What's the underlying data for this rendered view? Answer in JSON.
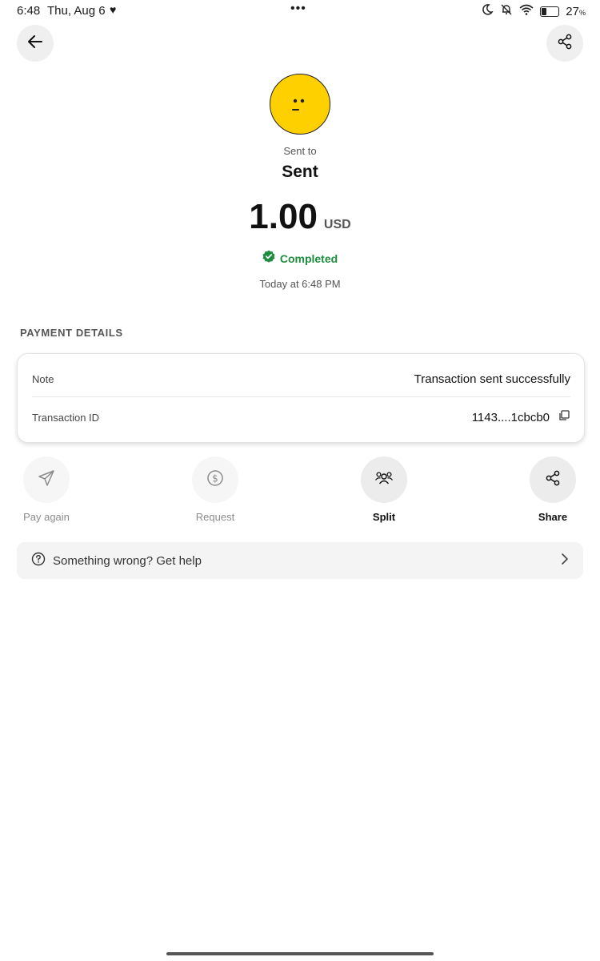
{
  "status_bar": {
    "time": "6:48",
    "date": "Thu, Aug 6",
    "battery_percent": "27",
    "battery_suffix": "%",
    "battery_level": 0.27
  },
  "header": {
    "back_icon": "arrow-left-icon",
    "share_icon": "share-icon"
  },
  "recipient": {
    "sent_to_label": "Sent to",
    "name": "Sent",
    "avatar_color": "#ffd000"
  },
  "transaction": {
    "amount": "1.00",
    "currency": "USD",
    "status": "Completed",
    "status_color": "#1e8e3e",
    "timestamp": "Today at 6:48 PM"
  },
  "payment_details": {
    "title": "PAYMENT DETAILS",
    "note_label": "Note",
    "note_value": "Transaction sent successfully",
    "txid_label": "Transaction ID",
    "txid_value": "1143....1cbcb0"
  },
  "actions": [
    {
      "label": "Pay again",
      "icon": "send-icon",
      "enabled": false
    },
    {
      "label": "Request",
      "icon": "dollar-circle-icon",
      "enabled": false
    },
    {
      "label": "Split",
      "icon": "group-icon",
      "enabled": true
    },
    {
      "label": "Share",
      "icon": "share-icon",
      "enabled": true
    }
  ],
  "help": {
    "text": "Something wrong? Get help"
  }
}
